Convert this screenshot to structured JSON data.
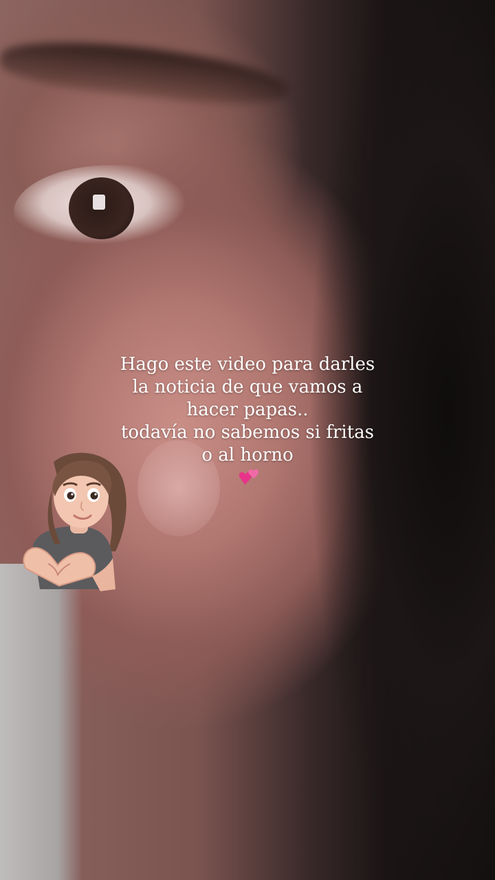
{
  "story": {
    "caption_lines": [
      "Hago este video para darles",
      "la noticia de que vamos a",
      "hacer papas..",
      "todavía no sabemos si fritas",
      "o al horno"
    ],
    "emoji": "💕",
    "sticker": "memoji-heart-hands"
  },
  "colors": {
    "caption_text": "#ffffff",
    "hearts": "#e8338a"
  }
}
